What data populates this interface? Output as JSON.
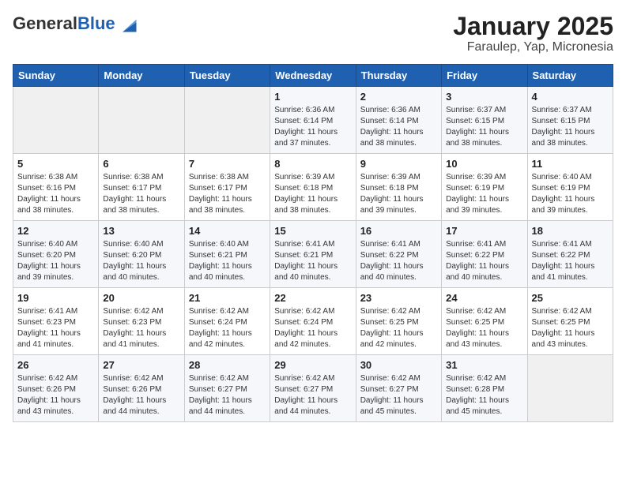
{
  "header": {
    "logo_general": "General",
    "logo_blue": "Blue",
    "title": "January 2025",
    "subtitle": "Faraulep, Yap, Micronesia"
  },
  "weekdays": [
    "Sunday",
    "Monday",
    "Tuesday",
    "Wednesday",
    "Thursday",
    "Friday",
    "Saturday"
  ],
  "weeks": [
    [
      {
        "day": "",
        "info": ""
      },
      {
        "day": "",
        "info": ""
      },
      {
        "day": "",
        "info": ""
      },
      {
        "day": "1",
        "info": "Sunrise: 6:36 AM\nSunset: 6:14 PM\nDaylight: 11 hours\nand 37 minutes."
      },
      {
        "day": "2",
        "info": "Sunrise: 6:36 AM\nSunset: 6:14 PM\nDaylight: 11 hours\nand 38 minutes."
      },
      {
        "day": "3",
        "info": "Sunrise: 6:37 AM\nSunset: 6:15 PM\nDaylight: 11 hours\nand 38 minutes."
      },
      {
        "day": "4",
        "info": "Sunrise: 6:37 AM\nSunset: 6:15 PM\nDaylight: 11 hours\nand 38 minutes."
      }
    ],
    [
      {
        "day": "5",
        "info": "Sunrise: 6:38 AM\nSunset: 6:16 PM\nDaylight: 11 hours\nand 38 minutes."
      },
      {
        "day": "6",
        "info": "Sunrise: 6:38 AM\nSunset: 6:17 PM\nDaylight: 11 hours\nand 38 minutes."
      },
      {
        "day": "7",
        "info": "Sunrise: 6:38 AM\nSunset: 6:17 PM\nDaylight: 11 hours\nand 38 minutes."
      },
      {
        "day": "8",
        "info": "Sunrise: 6:39 AM\nSunset: 6:18 PM\nDaylight: 11 hours\nand 38 minutes."
      },
      {
        "day": "9",
        "info": "Sunrise: 6:39 AM\nSunset: 6:18 PM\nDaylight: 11 hours\nand 39 minutes."
      },
      {
        "day": "10",
        "info": "Sunrise: 6:39 AM\nSunset: 6:19 PM\nDaylight: 11 hours\nand 39 minutes."
      },
      {
        "day": "11",
        "info": "Sunrise: 6:40 AM\nSunset: 6:19 PM\nDaylight: 11 hours\nand 39 minutes."
      }
    ],
    [
      {
        "day": "12",
        "info": "Sunrise: 6:40 AM\nSunset: 6:20 PM\nDaylight: 11 hours\nand 39 minutes."
      },
      {
        "day": "13",
        "info": "Sunrise: 6:40 AM\nSunset: 6:20 PM\nDaylight: 11 hours\nand 40 minutes."
      },
      {
        "day": "14",
        "info": "Sunrise: 6:40 AM\nSunset: 6:21 PM\nDaylight: 11 hours\nand 40 minutes."
      },
      {
        "day": "15",
        "info": "Sunrise: 6:41 AM\nSunset: 6:21 PM\nDaylight: 11 hours\nand 40 minutes."
      },
      {
        "day": "16",
        "info": "Sunrise: 6:41 AM\nSunset: 6:22 PM\nDaylight: 11 hours\nand 40 minutes."
      },
      {
        "day": "17",
        "info": "Sunrise: 6:41 AM\nSunset: 6:22 PM\nDaylight: 11 hours\nand 40 minutes."
      },
      {
        "day": "18",
        "info": "Sunrise: 6:41 AM\nSunset: 6:22 PM\nDaylight: 11 hours\nand 41 minutes."
      }
    ],
    [
      {
        "day": "19",
        "info": "Sunrise: 6:41 AM\nSunset: 6:23 PM\nDaylight: 11 hours\nand 41 minutes."
      },
      {
        "day": "20",
        "info": "Sunrise: 6:42 AM\nSunset: 6:23 PM\nDaylight: 11 hours\nand 41 minutes."
      },
      {
        "day": "21",
        "info": "Sunrise: 6:42 AM\nSunset: 6:24 PM\nDaylight: 11 hours\nand 42 minutes."
      },
      {
        "day": "22",
        "info": "Sunrise: 6:42 AM\nSunset: 6:24 PM\nDaylight: 11 hours\nand 42 minutes."
      },
      {
        "day": "23",
        "info": "Sunrise: 6:42 AM\nSunset: 6:25 PM\nDaylight: 11 hours\nand 42 minutes."
      },
      {
        "day": "24",
        "info": "Sunrise: 6:42 AM\nSunset: 6:25 PM\nDaylight: 11 hours\nand 43 minutes."
      },
      {
        "day": "25",
        "info": "Sunrise: 6:42 AM\nSunset: 6:25 PM\nDaylight: 11 hours\nand 43 minutes."
      }
    ],
    [
      {
        "day": "26",
        "info": "Sunrise: 6:42 AM\nSunset: 6:26 PM\nDaylight: 11 hours\nand 43 minutes."
      },
      {
        "day": "27",
        "info": "Sunrise: 6:42 AM\nSunset: 6:26 PM\nDaylight: 11 hours\nand 44 minutes."
      },
      {
        "day": "28",
        "info": "Sunrise: 6:42 AM\nSunset: 6:27 PM\nDaylight: 11 hours\nand 44 minutes."
      },
      {
        "day": "29",
        "info": "Sunrise: 6:42 AM\nSunset: 6:27 PM\nDaylight: 11 hours\nand 44 minutes."
      },
      {
        "day": "30",
        "info": "Sunrise: 6:42 AM\nSunset: 6:27 PM\nDaylight: 11 hours\nand 45 minutes."
      },
      {
        "day": "31",
        "info": "Sunrise: 6:42 AM\nSunset: 6:28 PM\nDaylight: 11 hours\nand 45 minutes."
      },
      {
        "day": "",
        "info": ""
      }
    ]
  ]
}
